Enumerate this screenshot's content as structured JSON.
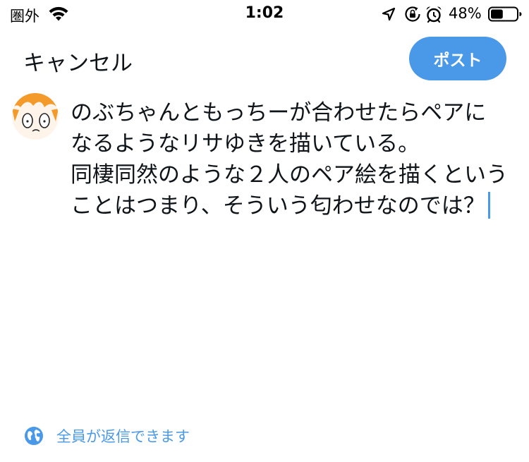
{
  "status_bar": {
    "carrier": "圏外",
    "time": "1:02",
    "battery_percent": "48%",
    "battery_level": 0.48,
    "icons": [
      "wifi-icon",
      "location-icon",
      "rotation-lock-icon",
      "alarm-icon",
      "battery-icon"
    ]
  },
  "compose": {
    "cancel_label": "キャンセル",
    "post_label": "ポスト",
    "tweet_text": "のぶちゃんともっちーが合わせたらペアに\nなるようなリサゆきを描いている。\n同棲同然のような２人のペア絵を描くという\nことはつまり、そういう匂わせなのでは？",
    "reply_setting_label": "全員が返信できます"
  },
  "colors": {
    "accent": "#4a99e9",
    "text": "#0f1419",
    "background": "#ffffff"
  }
}
